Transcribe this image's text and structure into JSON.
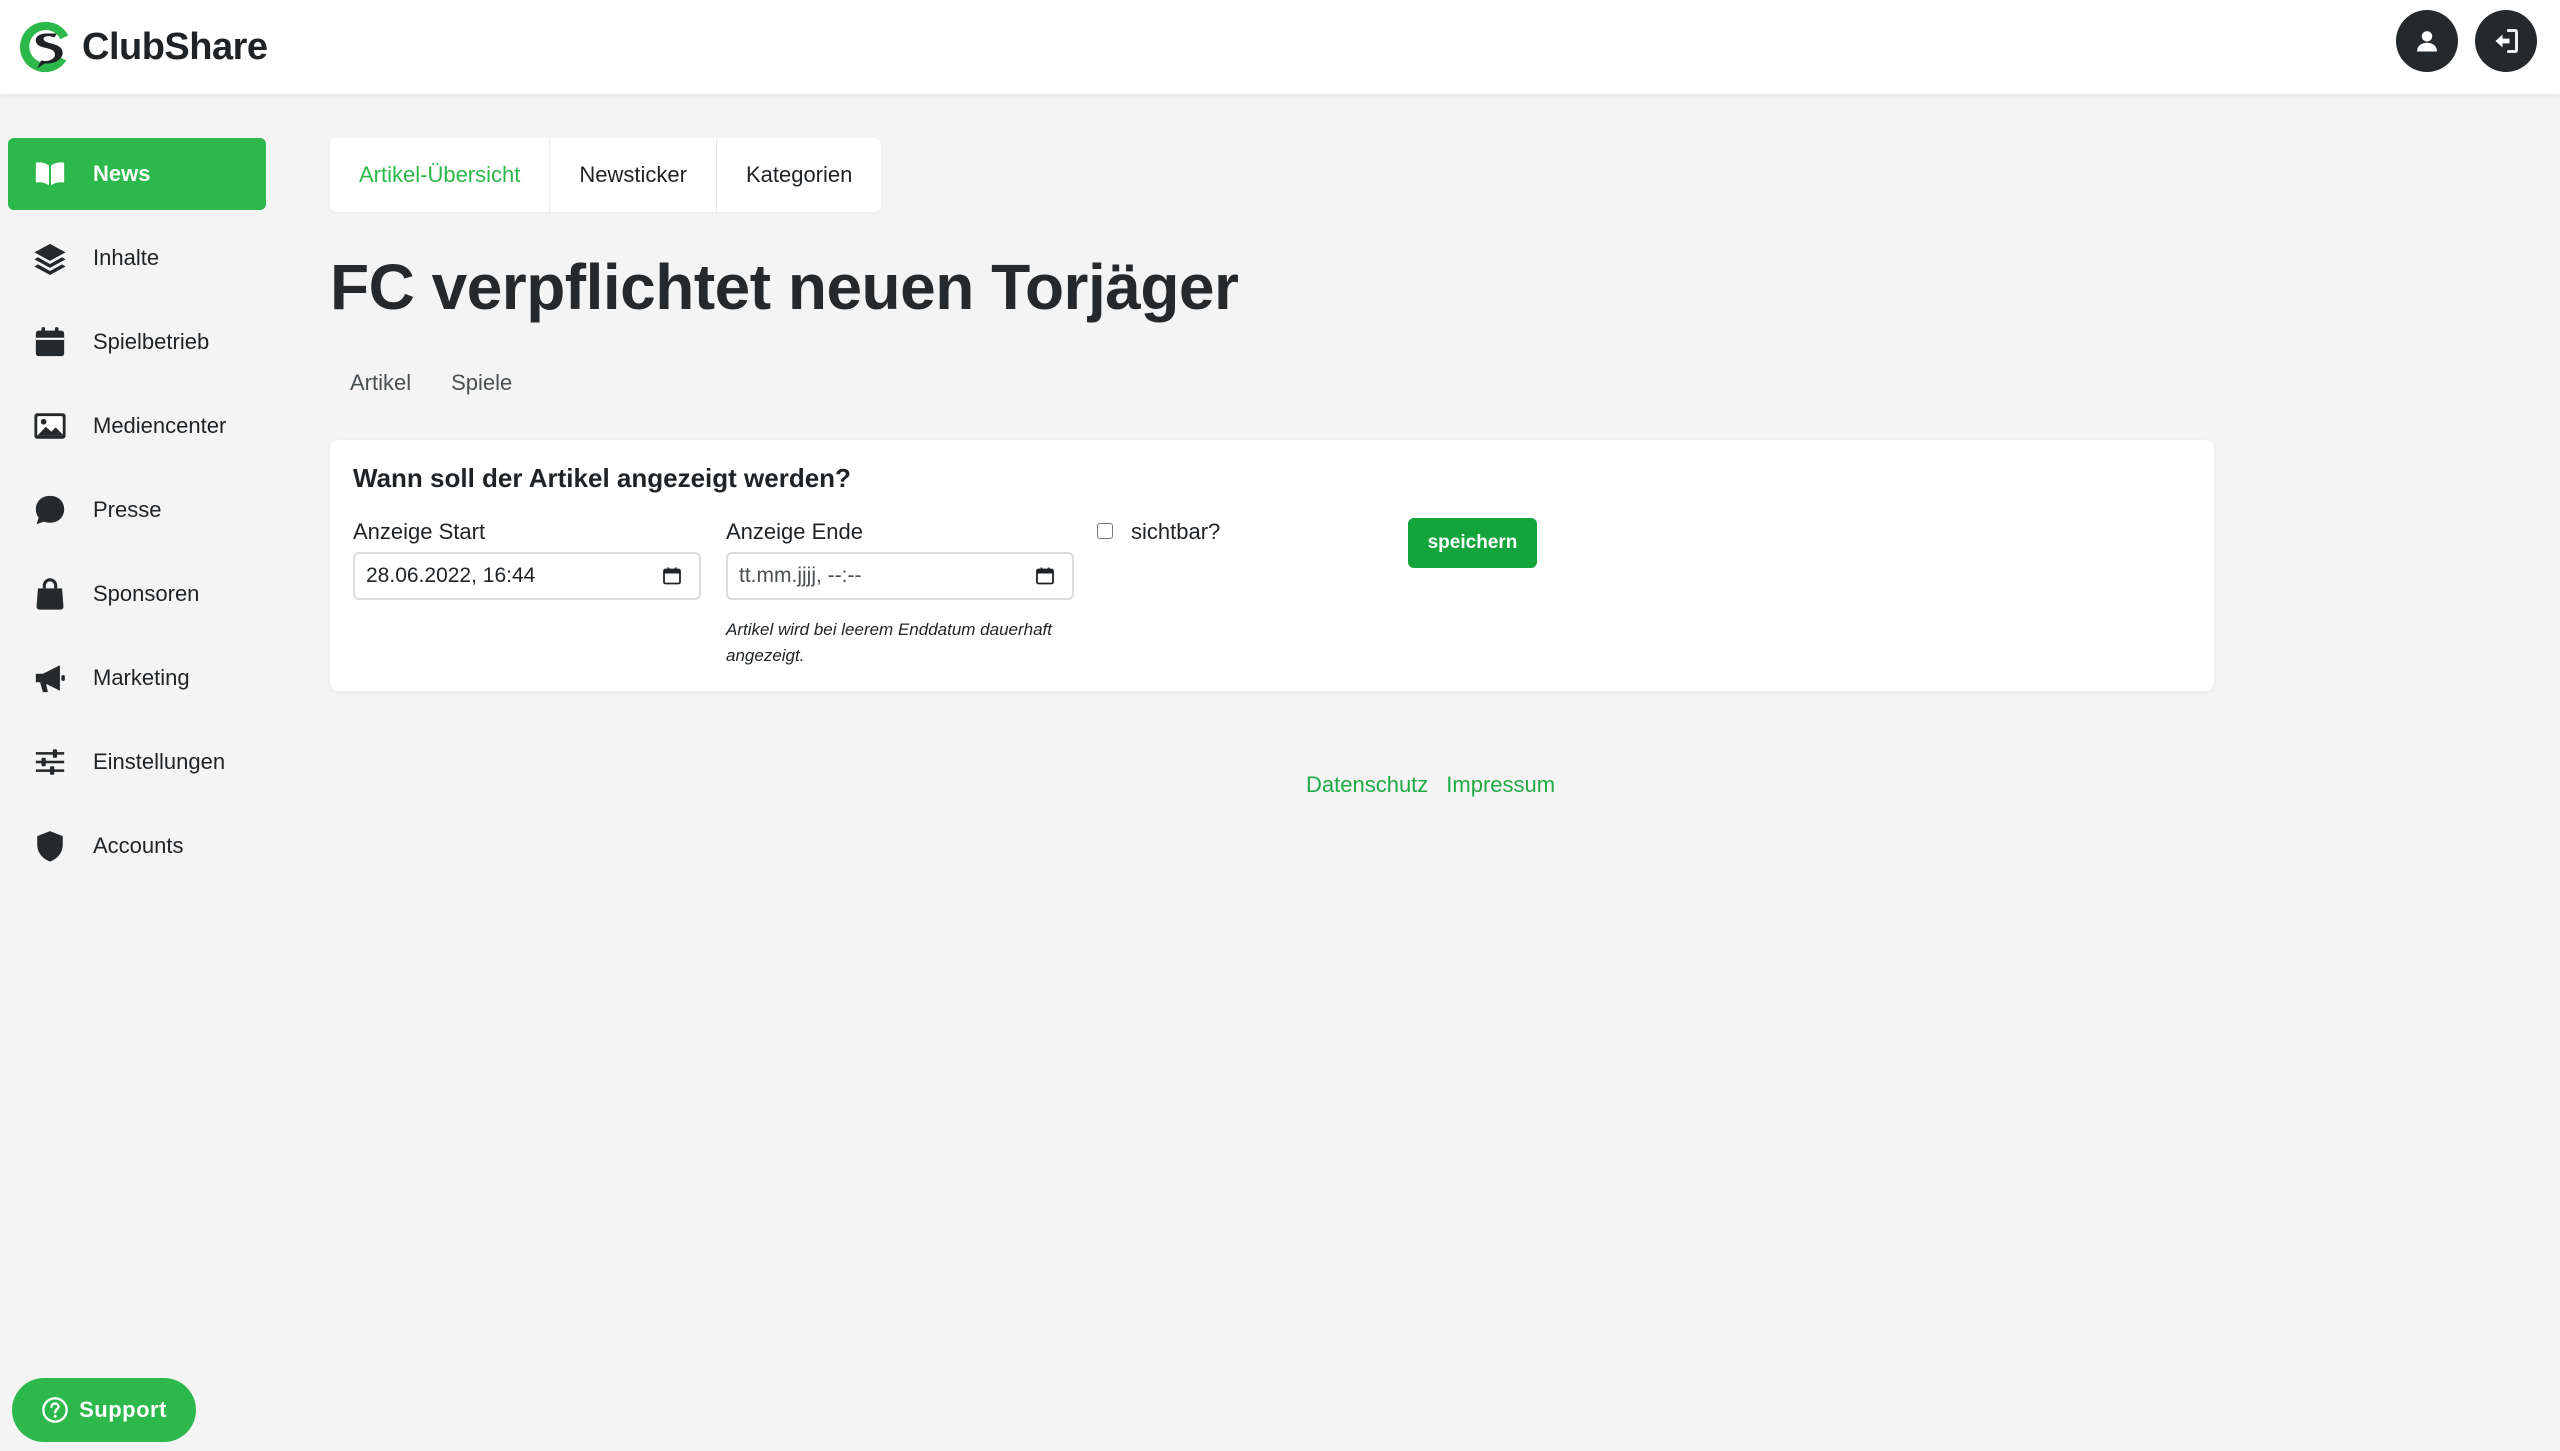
{
  "brand": {
    "name": "ClubShare",
    "accent_color": "#2cb84a",
    "logo_icon": "clubshare-logo-icon"
  },
  "header": {
    "user_icon": "user-icon",
    "logout_icon": "logout-icon"
  },
  "sidebar": {
    "items": [
      {
        "label": "News",
        "icon": "book-open-icon",
        "active": true
      },
      {
        "label": "Inhalte",
        "icon": "layers-icon"
      },
      {
        "label": "Spielbetrieb",
        "icon": "calendar-icon"
      },
      {
        "label": "Mediencenter",
        "icon": "image-icon"
      },
      {
        "label": "Presse",
        "icon": "chat-bubble-icon"
      },
      {
        "label": "Sponsoren",
        "icon": "shopping-bag-icon"
      },
      {
        "label": "Marketing",
        "icon": "megaphone-icon"
      },
      {
        "label": "Einstellungen",
        "icon": "sliders-icon"
      },
      {
        "label": "Accounts",
        "icon": "shield-icon"
      }
    ]
  },
  "tabs": [
    {
      "label": "Artikel-Übersicht",
      "active": true
    },
    {
      "label": "Newsticker"
    },
    {
      "label": "Kategorien"
    }
  ],
  "page": {
    "title": "FC verpflichtet neuen Torjäger",
    "subtabs": [
      "Artikel",
      "Spiele"
    ]
  },
  "schedule": {
    "heading": "Wann soll der Artikel angezeigt werden?",
    "start_label": "Anzeige Start",
    "start_value": "28.06.2022, 16:44",
    "end_label": "Anzeige Ende",
    "end_placeholder": "tt.mm.jjjj, --:--",
    "end_hint": "Artikel wird bei leerem Enddatum dauerhaft angezeigt.",
    "visible_label": "sichtbar?",
    "visible_checked": false,
    "save_label": "speichern"
  },
  "footer": {
    "links": [
      "Datenschutz",
      "Impressum"
    ]
  },
  "support": {
    "label": "Support",
    "icon": "help-circle-icon"
  }
}
